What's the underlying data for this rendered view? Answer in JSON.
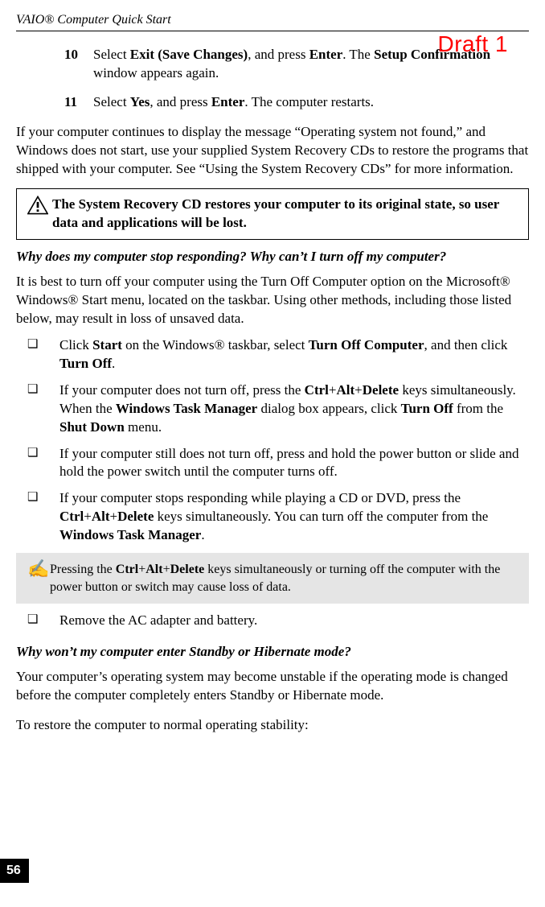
{
  "header": "VAIO® Computer Quick Start",
  "draft_stamp": "Draft 1",
  "steps": [
    {
      "num": "10",
      "text_parts": [
        {
          "t": "Select ",
          "b": false
        },
        {
          "t": "Exit (Save Changes)",
          "b": true
        },
        {
          "t": ", and press ",
          "b": false
        },
        {
          "t": "Enter",
          "b": true
        },
        {
          "t": ". The ",
          "b": false
        },
        {
          "t": "Setup Confirmation",
          "b": true
        },
        {
          "t": " window appears again.",
          "b": false
        }
      ]
    },
    {
      "num": "11",
      "text_parts": [
        {
          "t": "Select ",
          "b": false
        },
        {
          "t": "Yes",
          "b": true
        },
        {
          "t": ", and press ",
          "b": false
        },
        {
          "t": "Enter",
          "b": true
        },
        {
          "t": ". The computer restarts.",
          "b": false
        }
      ]
    }
  ],
  "para_os_not_found": "If your computer continues to display the message “Operating system not found,” and Windows does not start, use your supplied System Recovery CDs to restore the programs that shipped with your computer. See “Using the System Recovery CDs” for more information.",
  "caution_text": "The System Recovery CD restores your computer to its original state, so user data and applications will be lost.",
  "question1": "Why does my computer stop responding? Why can’t I turn off my computer?",
  "para_turnoff_intro": "It is best to turn off your computer using the Turn Off Computer option on the Microsoft® Windows® Start menu, located on the taskbar. Using other methods, including those listed below, may result in loss of unsaved data.",
  "bullets_a": [
    [
      {
        "t": "Click ",
        "b": false
      },
      {
        "t": "Start",
        "b": true
      },
      {
        "t": " on the Windows® taskbar, select ",
        "b": false
      },
      {
        "t": "Turn Off Computer",
        "b": true
      },
      {
        "t": ", and then click ",
        "b": false
      },
      {
        "t": "Turn Off",
        "b": true
      },
      {
        "t": ".",
        "b": false
      }
    ],
    [
      {
        "t": "If your computer does not turn off, press the ",
        "b": false
      },
      {
        "t": "Ctrl",
        "b": true
      },
      {
        "t": "+",
        "b": false
      },
      {
        "t": "Alt",
        "b": true
      },
      {
        "t": "+",
        "b": false
      },
      {
        "t": "Delete",
        "b": true
      },
      {
        "t": " keys simultaneously. When the ",
        "b": false
      },
      {
        "t": "Windows Task Manager",
        "b": true
      },
      {
        "t": " dialog box appears, click ",
        "b": false
      },
      {
        "t": "Turn Off",
        "b": true
      },
      {
        "t": " from the ",
        "b": false
      },
      {
        "t": "Shut Down",
        "b": true
      },
      {
        "t": " menu.",
        "b": false
      }
    ],
    [
      {
        "t": "If your computer still does not turn off, press and hold the power button or slide and hold the power switch until the computer turns off.",
        "b": false
      }
    ],
    [
      {
        "t": "If your computer stops responding while playing a CD or DVD, press the ",
        "b": false
      },
      {
        "t": "Ctrl",
        "b": true
      },
      {
        "t": "+",
        "b": false
      },
      {
        "t": "Alt",
        "b": true
      },
      {
        "t": "+",
        "b": false
      },
      {
        "t": "Delete",
        "b": true
      },
      {
        "t": " keys simultaneously. You can turn off the computer from the ",
        "b": false
      },
      {
        "t": "Windows Task Manager",
        "b": true
      },
      {
        "t": ".",
        "b": false
      }
    ]
  ],
  "note_glyph": "✍",
  "note_parts": [
    {
      "t": "Pressing the ",
      "b": false
    },
    {
      "t": "Ctrl",
      "b": true
    },
    {
      "t": "+",
      "b": false
    },
    {
      "t": "Alt",
      "b": true
    },
    {
      "t": "+",
      "b": false
    },
    {
      "t": "Delete",
      "b": true
    },
    {
      "t": " keys simultaneously or turning off the computer with the power button or switch may cause loss of data.",
      "b": false
    }
  ],
  "bullets_b": [
    [
      {
        "t": "Remove the AC adapter and battery.",
        "b": false
      }
    ]
  ],
  "question2": "Why won’t my computer enter Standby or Hibernate mode?",
  "para_standby": "Your computer’s operating system may become unstable if the operating mode is changed before the computer completely enters Standby or Hibernate mode.",
  "para_restore": "To restore the computer to normal operating stability:",
  "page_num": "56"
}
